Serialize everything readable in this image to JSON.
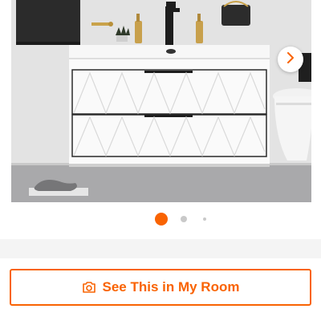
{
  "gallery": {
    "image_label": "Floating white bathroom vanity with two drawers",
    "next_icon": "chevron-right-icon",
    "dots": {
      "count": 3,
      "active_index": 0
    }
  },
  "room_button": {
    "label": "See This in My Room",
    "icon": "camera-icon"
  },
  "colors": {
    "accent": "#f96302",
    "inactive_dot": "#c9c9c9",
    "band": "#f4f4f4"
  }
}
